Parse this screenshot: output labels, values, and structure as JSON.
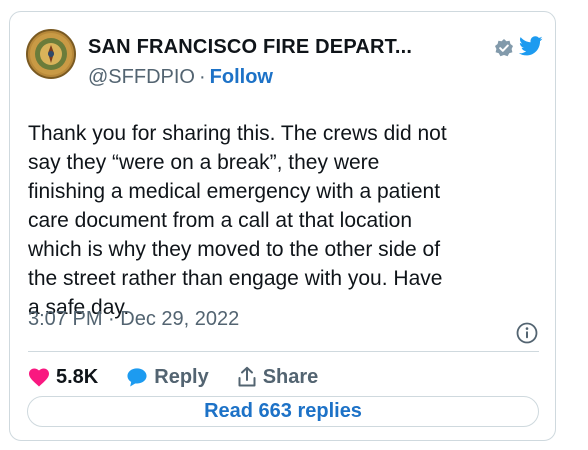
{
  "author": {
    "display_name": "SAN FRANCISCO FIRE DEPART...",
    "handle": "@SFFDPIO",
    "separator": "·",
    "follow_label": "Follow"
  },
  "tweet": {
    "text": "Thank you for sharing this. The crews did not\nsay they “were on a break”, they were\nfinishing a medical emergency with a patient\ncare document from a call at that location\nwhich is why they moved to the other side of\nthe street rather than engage with you. Have\na safe day.",
    "timestamp": "3:07 PM · Dec 29, 2022"
  },
  "actions": {
    "likes": "5.8K",
    "reply_label": "Reply",
    "share_label": "Share"
  },
  "read_replies_label": "Read 663 replies",
  "colors": {
    "accent": "#1d9bf0",
    "link": "#1d72c7",
    "like": "#f91880",
    "muted": "#536471"
  }
}
